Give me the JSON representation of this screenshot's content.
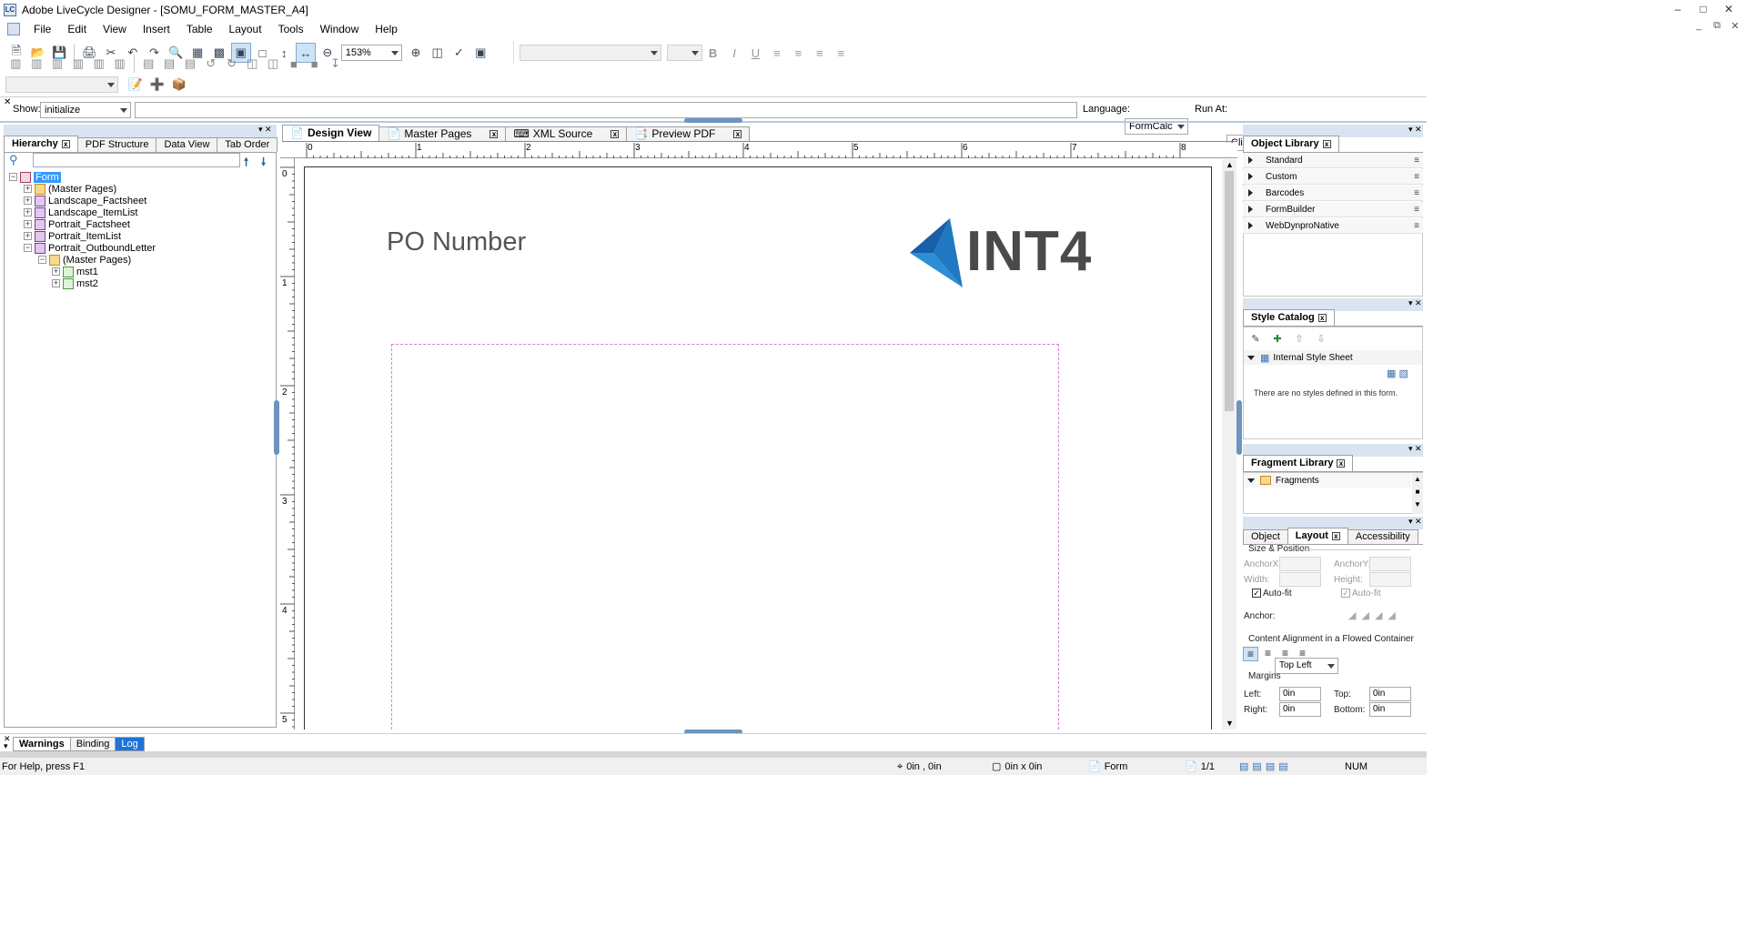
{
  "window": {
    "app_icon": "LC",
    "title": "Adobe LiveCycle Designer - [SOMU_FORM_MASTER_A4]"
  },
  "menu": [
    "File",
    "Edit",
    "View",
    "Insert",
    "Table",
    "Layout",
    "Tools",
    "Window",
    "Help"
  ],
  "toolbar": {
    "zoom": "153%"
  },
  "script_bar": {
    "show_label": "Show:",
    "show_value": "initialize",
    "language_label": "Language:",
    "language_value": "FormCalc",
    "run_at_label": "Run At:",
    "run_at_value": "Client"
  },
  "left_panel": {
    "tabs": [
      "Hierarchy",
      "PDF Structure",
      "Data View",
      "Tab Order"
    ],
    "tree": [
      {
        "label": "Form",
        "depth": 0,
        "expander": "−",
        "selected": true,
        "icon": "form-icon"
      },
      {
        "label": "(Master Pages)",
        "depth": 1,
        "expander": "+",
        "icon": "master-pages-icon"
      },
      {
        "label": "Landscape_Factsheet",
        "depth": 1,
        "expander": "+",
        "icon": "subform-icon"
      },
      {
        "label": "Landscape_ItemList",
        "depth": 1,
        "expander": "+",
        "icon": "subform-icon"
      },
      {
        "label": "Portrait_Factsheet",
        "depth": 1,
        "expander": "+",
        "icon": "subform-icon"
      },
      {
        "label": "Portrait_ItemList",
        "depth": 1,
        "expander": "+",
        "icon": "subform-icon"
      },
      {
        "label": "Portrait_OutboundLetter",
        "depth": 1,
        "expander": "−",
        "icon": "subform-icon"
      },
      {
        "label": "(Master Pages)",
        "depth": 2,
        "expander": "−",
        "icon": "master-pages-icon"
      },
      {
        "label": "mst1",
        "depth": 3,
        "expander": "+",
        "icon": "page-icon"
      },
      {
        "label": "mst2",
        "depth": 3,
        "expander": "+",
        "icon": "page-icon"
      }
    ]
  },
  "doc_tabs": [
    "Design View",
    "Master Pages",
    "XML Source",
    "Preview PDF"
  ],
  "ruler": {
    "h": [
      "0",
      "1",
      "2",
      "3",
      "4",
      "5",
      "6",
      "7",
      "8"
    ],
    "v": [
      "0",
      "1",
      "2",
      "3",
      "4",
      "5"
    ]
  },
  "canvas": {
    "heading": "PO Number",
    "logo_text": "INT4"
  },
  "object_library": {
    "title": "Object Library",
    "items": [
      "Standard",
      "Custom",
      "Barcodes",
      "FormBuilder",
      "WebDynproNative"
    ]
  },
  "style_catalog": {
    "title": "Style Catalog",
    "sheet": "Internal Style Sheet",
    "empty": "There are no styles defined in this form."
  },
  "fragment_library": {
    "title": "Fragment Library",
    "item": "Fragments"
  },
  "properties": {
    "tabs": [
      "Object",
      "Layout",
      "Accessibility"
    ],
    "size_position": "Size & Position",
    "anchor_x": "AnchorX:",
    "anchor_y": "AnchorY:",
    "width": "Width:",
    "height": "Height:",
    "autofit": "Auto-fit",
    "anchor_label": "Anchor:",
    "anchor_value": "Top Left",
    "content_alignment": "Content Alignment in a Flowed Container",
    "margins": "Margins",
    "left": "Left:",
    "left_val": "0in",
    "top": "Top:",
    "top_val": "0in",
    "right": "Right:",
    "right_val": "0in",
    "bottom": "Bottom:",
    "bottom_val": "0in"
  },
  "bottom_tabs": [
    "Warnings",
    "Binding",
    "Log"
  ],
  "status": {
    "help": "For Help, press F1",
    "position": "0in , 0in",
    "size": "0in x 0in",
    "object": "Form",
    "page": "1/1",
    "num": "NUM"
  }
}
